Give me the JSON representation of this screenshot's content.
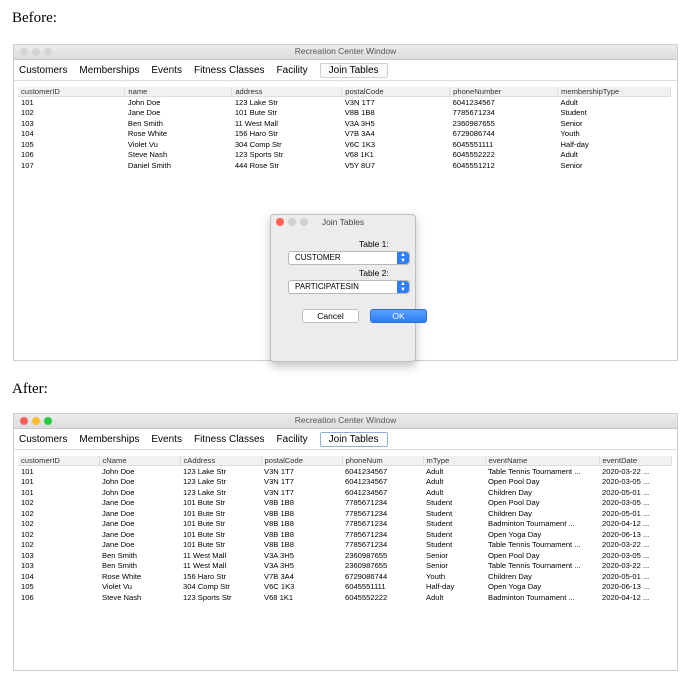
{
  "labels": {
    "before": "Before:",
    "after": "After:"
  },
  "window": {
    "title": "Recreation Center Window",
    "light_colors_inactive": [
      "#cfcfcf",
      "#cfcfcf",
      "#cfcfcf"
    ],
    "light_colors_active": [
      "#fe5f57",
      "#febc2e",
      "#28c840"
    ],
    "menu": [
      "Customers",
      "Memberships",
      "Events",
      "Fitness Classes",
      "Facility",
      "Join Tables"
    ]
  },
  "before_table": {
    "headers": [
      "customerID",
      "name",
      "address",
      "postalCode",
      "phoneNumber",
      "membershipType"
    ],
    "rows": [
      [
        "101",
        "John Doe",
        "123 Lake Str",
        "V3N 1T7",
        "6041234567",
        "Adult"
      ],
      [
        "102",
        "Jane Doe",
        "101 Bute Str",
        "V8B 1B8",
        "7785671234",
        "Student"
      ],
      [
        "103",
        "Ben Smith",
        "11 West Mall",
        "V3A 3H5",
        "2360987655",
        "Senior"
      ],
      [
        "104",
        "Rose White",
        "156 Haro Str",
        "V7B 3A4",
        "6729086744",
        "Youth"
      ],
      [
        "105",
        "Violet Vu",
        "304 Comp Str",
        "V6C 1K3",
        "6045551111",
        "Half-day"
      ],
      [
        "106",
        "Steve Nash",
        "123 Sports Str",
        "V68 1K1",
        "6045552222",
        "Adult"
      ],
      [
        "107",
        "Daniel Smith",
        "444 Rose Str",
        "V5Y 8U7",
        "6045551212",
        "Senior"
      ]
    ]
  },
  "dialog": {
    "title": "Join Tables",
    "table1_label": "Table 1:",
    "table1_value": "CUSTOMER",
    "table2_label": "Table 2:",
    "table2_value": "PARTICIPATESIN",
    "cancel": "Cancel",
    "ok": "OK"
  },
  "after_table": {
    "headers": [
      "customerID",
      "cName",
      "cAddress",
      "postalCode",
      "phoneNum",
      "mType",
      "eventName",
      "eventDate"
    ],
    "rows": [
      [
        "101",
        "John Doe",
        "123 Lake Str",
        "V3N 1T7",
        "6041234567",
        "Adult",
        "Table Tennis Tournament ...",
        "2020-03-22 ..."
      ],
      [
        "101",
        "John Doe",
        "123 Lake Str",
        "V3N 1T7",
        "6041234567",
        "Adult",
        "Open Pool Day",
        "2020-03-05 ..."
      ],
      [
        "101",
        "John Doe",
        "123 Lake Str",
        "V3N 1T7",
        "6041234567",
        "Adult",
        "Children Day",
        "2020-05-01 ..."
      ],
      [
        "102",
        "Jane Doe",
        "101 Bute Str",
        "V8B 1B8",
        "7785671234",
        "Student",
        "Open Pool Day",
        "2020-03-05 ..."
      ],
      [
        "102",
        "Jane Doe",
        "101 Bute Str",
        "V8B 1B8",
        "7785671234",
        "Student",
        "Children Day",
        "2020-05-01 ..."
      ],
      [
        "102",
        "Jane Doe",
        "101 Bute Str",
        "V8B 1B8",
        "7785671234",
        "Student",
        "Badminton Tournament    ...",
        "2020-04-12 ..."
      ],
      [
        "102",
        "Jane Doe",
        "101 Bute Str",
        "V8B 1B8",
        "7785671234",
        "Student",
        "Open Yoga Day",
        "2020-06-13 ..."
      ],
      [
        "102",
        "Jane Doe",
        "101 Bute Str",
        "V8B 1B8",
        "7785671234",
        "Student",
        "Table Tennis Tournament ...",
        "2020-03-22 ..."
      ],
      [
        "103",
        "Ben Smith",
        "11 West Mall",
        "V3A 3H5",
        "2360987655",
        "Senior",
        "Open Pool Day",
        "2020-03-05 ..."
      ],
      [
        "103",
        "Ben Smith",
        "11 West Mall",
        "V3A 3H5",
        "2360987655",
        "Senior",
        "Table Tennis Tournament ...",
        "2020-03-22 ..."
      ],
      [
        "104",
        "Rose White",
        "156 Haro Str",
        "V7B 3A4",
        "6729086744",
        "Youth",
        "Children Day",
        "2020-05-01 ..."
      ],
      [
        "105",
        "Violet Vu",
        "304 Comp Str",
        "V6C 1K3",
        "6045551111",
        "Half-day",
        "Open Yoga Day",
        "2020-06-13 ..."
      ],
      [
        "106",
        "Steve Nash",
        "123 Sports Str",
        "V68 1K1",
        "6045552222",
        "Adult",
        "Badminton Tournament    ...",
        "2020-04-12 ..."
      ]
    ]
  }
}
